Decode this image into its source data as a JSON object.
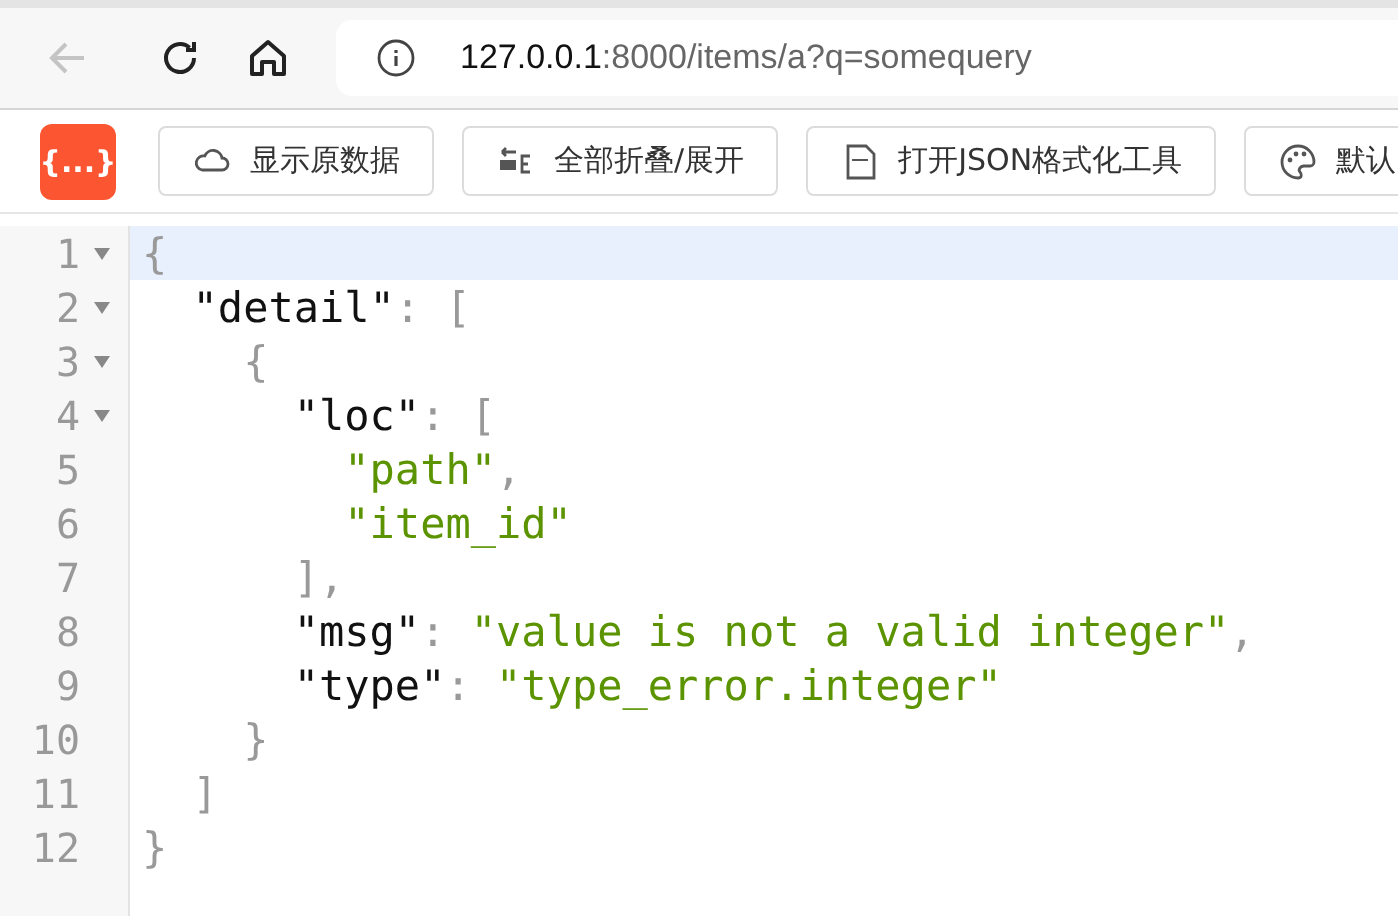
{
  "browser": {
    "back_disabled": true,
    "url_host": "127.0.0.1",
    "url_rest": ":8000/items/a?q=somequery"
  },
  "toolbar": {
    "logo": "{...}",
    "buttons": [
      {
        "kind": "cloud",
        "label": "显示原数据"
      },
      {
        "kind": "collapse",
        "label": "全部折叠/展开"
      },
      {
        "kind": "json",
        "label": "打开JSON格式化工具"
      },
      {
        "kind": "palette",
        "label": "默认"
      }
    ]
  },
  "code": {
    "lines": [
      {
        "number": "1",
        "foldable": true,
        "highlighted": true,
        "tokens": [
          {
            "kind": "punct",
            "text": "{"
          }
        ]
      },
      {
        "number": "2",
        "foldable": true,
        "highlighted": false,
        "tokens": [
          {
            "kind": "key",
            "text": "  \"detail\""
          },
          {
            "kind": "punct",
            "text": ": ["
          }
        ]
      },
      {
        "number": "3",
        "foldable": true,
        "highlighted": false,
        "tokens": [
          {
            "kind": "punct",
            "text": "    {"
          }
        ]
      },
      {
        "number": "4",
        "foldable": true,
        "highlighted": false,
        "tokens": [
          {
            "kind": "key",
            "text": "      \"loc\""
          },
          {
            "kind": "punct",
            "text": ": ["
          }
        ]
      },
      {
        "number": "5",
        "foldable": false,
        "highlighted": false,
        "tokens": [
          {
            "kind": "string",
            "text": "        \"path\""
          },
          {
            "kind": "punct",
            "text": ","
          }
        ]
      },
      {
        "number": "6",
        "foldable": false,
        "highlighted": false,
        "tokens": [
          {
            "kind": "string",
            "text": "        \"item_id\""
          }
        ]
      },
      {
        "number": "7",
        "foldable": false,
        "highlighted": false,
        "tokens": [
          {
            "kind": "punct",
            "text": "      ],"
          }
        ]
      },
      {
        "number": "8",
        "foldable": false,
        "highlighted": false,
        "tokens": [
          {
            "kind": "key",
            "text": "      \"msg\""
          },
          {
            "kind": "punct",
            "text": ": "
          },
          {
            "kind": "string",
            "text": "\"value is not a valid integer\""
          },
          {
            "kind": "punct",
            "text": ","
          }
        ]
      },
      {
        "number": "9",
        "foldable": false,
        "highlighted": false,
        "tokens": [
          {
            "kind": "key",
            "text": "      \"type\""
          },
          {
            "kind": "punct",
            "text": ": "
          },
          {
            "kind": "string",
            "text": "\"type_error.integer\""
          }
        ]
      },
      {
        "number": "10",
        "foldable": false,
        "highlighted": false,
        "tokens": [
          {
            "kind": "punct",
            "text": "    }"
          }
        ]
      },
      {
        "number": "11",
        "foldable": false,
        "highlighted": false,
        "tokens": [
          {
            "kind": "punct",
            "text": "  ]"
          }
        ]
      },
      {
        "number": "12",
        "foldable": false,
        "highlighted": false,
        "tokens": [
          {
            "kind": "punct",
            "text": "}"
          }
        ]
      }
    ]
  }
}
